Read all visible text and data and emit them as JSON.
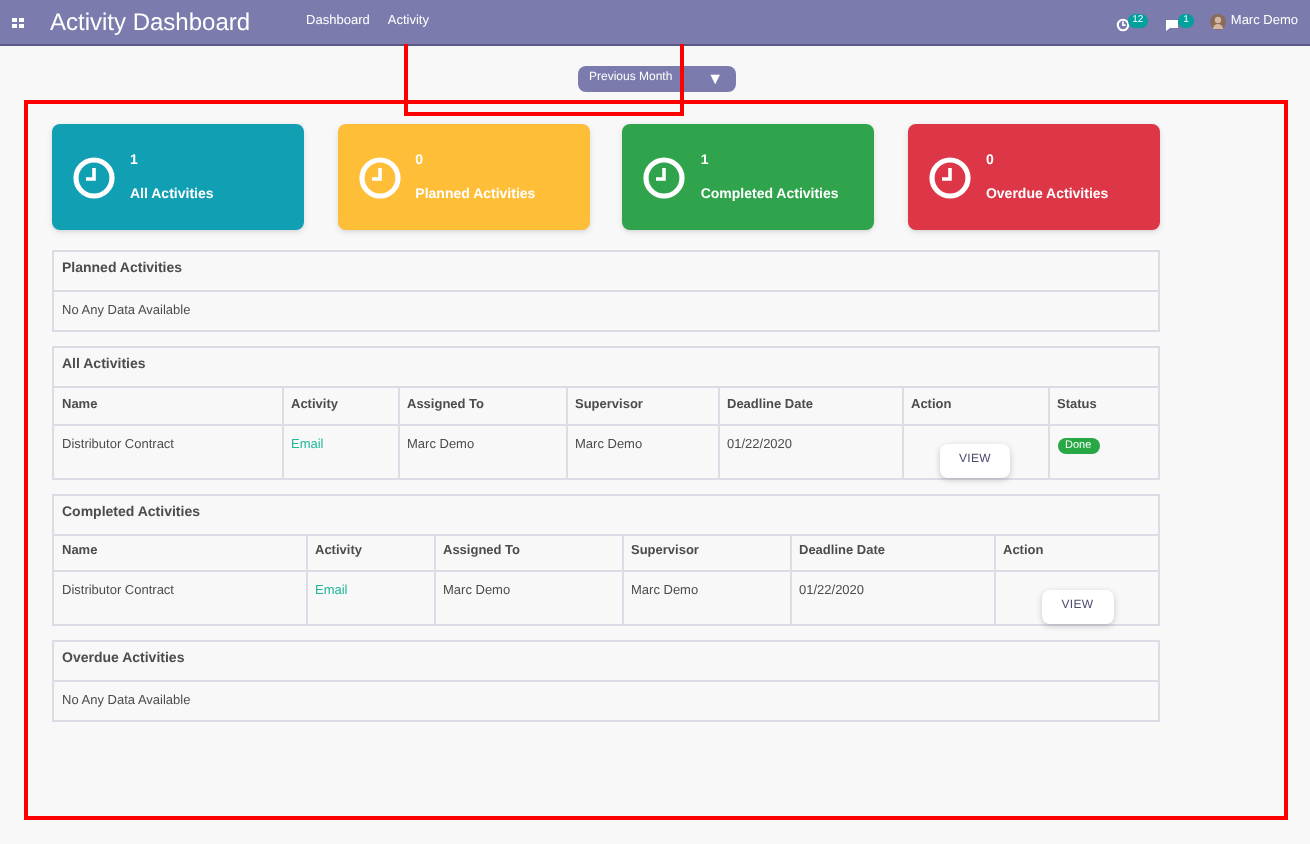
{
  "navbar": {
    "title": "Activity Dashboard",
    "menu": [
      "Dashboard",
      "Activity"
    ],
    "activity_count": "12",
    "message_count": "1",
    "user": "Marc Demo"
  },
  "filter": {
    "value": "Previous Month",
    "arrow": "▼"
  },
  "cards": [
    {
      "count": "1",
      "label": "All Activities",
      "color": "#119fb4"
    },
    {
      "count": "0",
      "label": "Planned Activities",
      "color": "#ffbe38"
    },
    {
      "count": "1",
      "label": "Completed Activities",
      "color": "#2fa44c"
    },
    {
      "count": "0",
      "label": "Overdue Activities",
      "color": "#dc3647"
    }
  ],
  "sections": [
    {
      "kind": "empty",
      "title": "Planned Activities",
      "message": "No Any Data Available"
    },
    {
      "kind": "table",
      "title": "All Activities",
      "columns": [
        "Name",
        "Activity",
        "Assigned To",
        "Supervisor",
        "Deadline Date",
        "Action",
        "Status"
      ],
      "rows": [
        {
          "cells": [
            {
              "kind": "text",
              "text": "Distributor Contract"
            },
            {
              "kind": "link",
              "text": "Email"
            },
            {
              "kind": "text",
              "text": "Marc Demo"
            },
            {
              "kind": "text",
              "text": "Marc Demo"
            },
            {
              "kind": "text",
              "text": "01/22/2020"
            },
            {
              "kind": "button",
              "text": "VIEW"
            },
            {
              "kind": "badge",
              "text": "Done"
            }
          ]
        }
      ]
    },
    {
      "kind": "table",
      "title": "Completed Activities",
      "columns": [
        "Name",
        "Activity",
        "Assigned To",
        "Supervisor",
        "Deadline Date",
        "Action"
      ],
      "rows": [
        {
          "cells": [
            {
              "kind": "text",
              "text": "Distributor Contract"
            },
            {
              "kind": "link",
              "text": "Email"
            },
            {
              "kind": "text",
              "text": "Marc Demo"
            },
            {
              "kind": "text",
              "text": "Marc Demo"
            },
            {
              "kind": "text",
              "text": "01/22/2020"
            },
            {
              "kind": "button",
              "text": "VIEW"
            }
          ]
        }
      ]
    },
    {
      "kind": "empty",
      "title": "Overdue Activities",
      "message": "No Any Data Available"
    }
  ]
}
